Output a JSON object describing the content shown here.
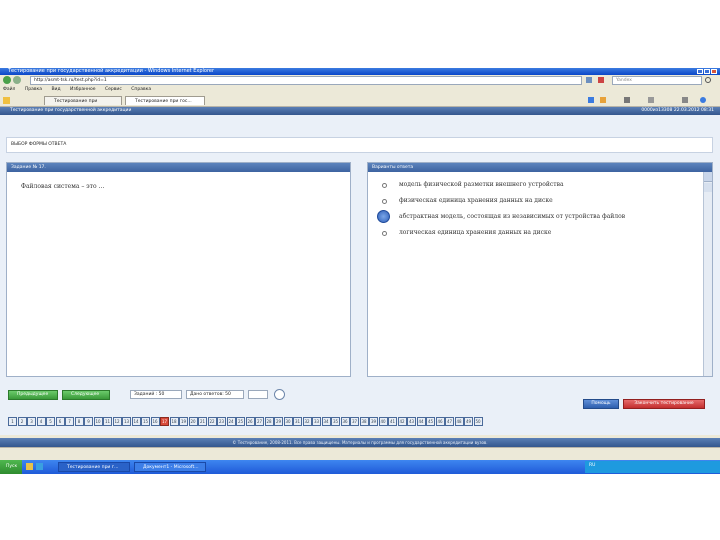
{
  "window": {
    "title": "Тестирование при государственной аккредитации - Windows Internet Explorer",
    "address": "http://asmt-tsk.ru/test.php?id=1",
    "search_placeholder": "Yandex",
    "menu": [
      "Файл",
      "Правка",
      "Вид",
      "Избранное",
      "Сервис",
      "Справка"
    ],
    "tabs": [
      "Тестирование при государ...",
      "Тестирование при гос..."
    ]
  },
  "app": {
    "title": "Тестирование при государственной аккредитации",
    "session_info": "0000из13308 22.03.2012 08:31",
    "subheader": "ВЫБОР ФОРМЫ ОТВЕТА"
  },
  "question": {
    "header": "Задание № 17.",
    "text": "Файловая система – это …"
  },
  "answers": {
    "header": "Варианты ответа",
    "options": [
      "модель физической разметки внешнего устройства",
      "физическая единица хранения данных на диске",
      "абстрактная модель, состоящая из независимых от устройства файлов",
      "логическая единица хранения данных на диске"
    ],
    "selected_index": 2
  },
  "nav": {
    "prev_label": "Предыдущее",
    "next_label": "Следующее",
    "total_label": "Заданий : 50",
    "answered_label": "Дано ответов: 50",
    "help_label": "Помощь",
    "finish_label": "Закончить тестирование",
    "numbers": [
      "1",
      "2",
      "3",
      "4",
      "5",
      "6",
      "7",
      "8",
      "9",
      "10",
      "11",
      "12",
      "13",
      "14",
      "15",
      "16",
      "17",
      "18",
      "19",
      "20",
      "21",
      "22",
      "23",
      "24",
      "25",
      "26",
      "27",
      "28",
      "29",
      "30",
      "31",
      "32",
      "33",
      "34",
      "35",
      "36",
      "37",
      "38",
      "39",
      "40",
      "41",
      "42",
      "43",
      "44",
      "45",
      "46",
      "47",
      "48",
      "49",
      "50"
    ],
    "current_number": "17"
  },
  "footer": {
    "text": "© Тестирование, 2008-2011. Все права защищены. Материалы и программы для государственной аккредитации вузов."
  },
  "taskbar": {
    "start_label": "Пуск",
    "items": [
      "Тестирование при г...",
      "Документ1 - Microsoft..."
    ],
    "lang": "RU"
  },
  "colors": {
    "accent_blue": "#3d63a0",
    "green_button": "#3a9a3a",
    "red_button": "#c32e2e",
    "taskbar": "#1f5ad8"
  }
}
